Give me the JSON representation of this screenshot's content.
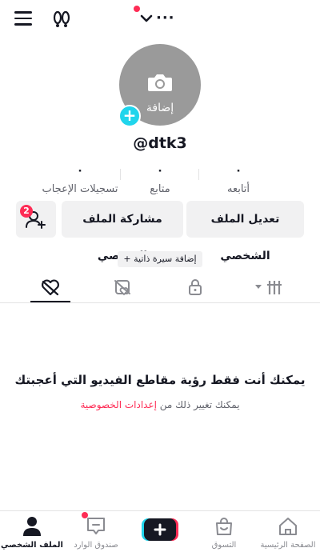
{
  "topbar": {
    "menu_icon": "hamburger-menu-icon",
    "footprints_icon": "footprints-icon",
    "account_switcher_icon": "chevron-down-icon",
    "notification_dot_color": "#fe2c55"
  },
  "profile": {
    "avatar_add_label": "إضافة",
    "username": "@dtk3"
  },
  "stats": [
    {
      "value": "٠",
      "label": "تسجيلات الإعجاب"
    },
    {
      "value": "٠",
      "label": "متابع"
    },
    {
      "value": "٠",
      "label": "أتابعه"
    }
  ],
  "actions": {
    "edit_profile": "تعديل الملف الشخصي",
    "share_profile": "مشاركة الملف الشخصي",
    "add_friends_badge": "2"
  },
  "bio": {
    "add_bio": "+ إضافة سيرة ذاتية"
  },
  "tabs": [
    {
      "icon": "liked-videos-icon",
      "active": true
    },
    {
      "icon": "hidden-likes-icon",
      "active": false
    },
    {
      "icon": "lock-icon",
      "active": false
    },
    {
      "icon": "grid-videos-icon",
      "active": false
    }
  ],
  "empty_state": {
    "title": "يمكنك أنت فقط رؤية مقاطع الفيديو التي أعجبتك",
    "subtitle_prefix": "يمكنك تغيير ذلك من",
    "subtitle_link": "إعدادات الخصوصية"
  },
  "bottom_nav": {
    "home": "الصفحة الرئيسية",
    "shop": "التسوق",
    "inbox": "صندوق الوارد",
    "profile": "الملف الشخصي"
  },
  "colors": {
    "accent": "#fe2c55",
    "cyan": "#20d5ec",
    "text": "#161823",
    "muted": "#60626b",
    "button_bg": "#f1f1f2"
  }
}
